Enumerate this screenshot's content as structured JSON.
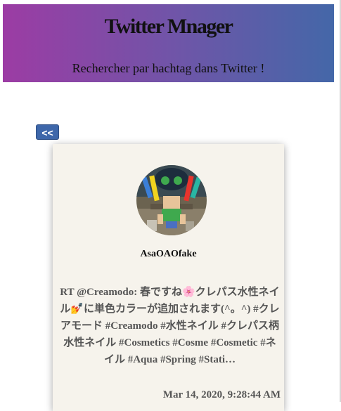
{
  "header": {
    "title": "Twitter Mnager",
    "subtitle": "Rechercher par hachtag dans Twitter !"
  },
  "navigation": {
    "back_label": "<<"
  },
  "tweet": {
    "username": "AsaOAOfake",
    "text": "RT @Creamodo: 春ですね🌸クレパス水性ネイル💅に単色カラーが追加されます(^。^) #クレアモード #Creamodo #水性ネイル #クレパス柄水性ネイル #Cosmetics #Cosme #Cosmetic #ネイル #Aqua #Spring #Stati…",
    "date": "Mar 14, 2020, 9:28:44 AM"
  },
  "colors": {
    "header_gradient_start": "#9c3ca4",
    "header_gradient_end": "#4467a8",
    "button": "#3e67aa",
    "card_background": "#f6f3ec"
  }
}
